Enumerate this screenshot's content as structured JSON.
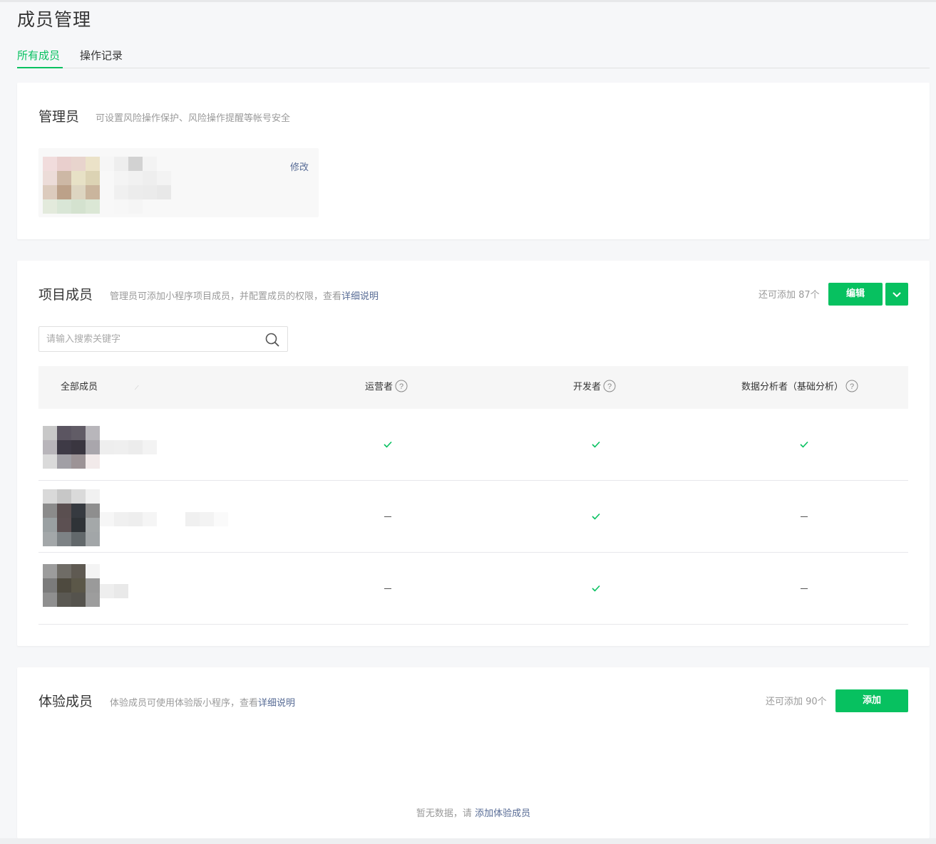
{
  "page": {
    "title": "成员管理"
  },
  "tabs": [
    {
      "label": "所有成员",
      "active": true
    },
    {
      "label": "操作记录",
      "active": false
    }
  ],
  "admin": {
    "title": "管理员",
    "desc": "可设置风险操作保护、风险操作提醒等帐号安全",
    "modify_label": "修改"
  },
  "project": {
    "title": "项目成员",
    "desc": "管理员可添加小程序项目成员，并配置成员的权限，查看",
    "desc_link": "详细说明",
    "quota": "还可添加 87个",
    "edit_label": "编辑",
    "search": {
      "placeholder": "请输入搜索关键字",
      "value": ""
    },
    "columns": [
      "全部成员",
      "运营者",
      "开发者",
      "数据分析者（基础分析）"
    ],
    "rows": [
      {
        "operator": true,
        "developer": true,
        "analyst": true
      },
      {
        "operator": false,
        "developer": true,
        "analyst": false
      },
      {
        "operator": false,
        "developer": true,
        "analyst": false
      }
    ]
  },
  "experience": {
    "title": "体验成员",
    "desc": "体验成员可使用体验版小程序，查看",
    "desc_link": "详细说明",
    "quota": "还可添加 90个",
    "add_label": "添加",
    "empty_text": "暂无数据，请 ",
    "empty_link": "添加体验成员"
  },
  "colors": {
    "accent": "#07c160",
    "link": "#576b95",
    "muted": "#9a9a9a"
  },
  "icons": [
    "search-icon",
    "help-icon",
    "chevron-down-icon",
    "check-icon",
    "dash-icon"
  ]
}
